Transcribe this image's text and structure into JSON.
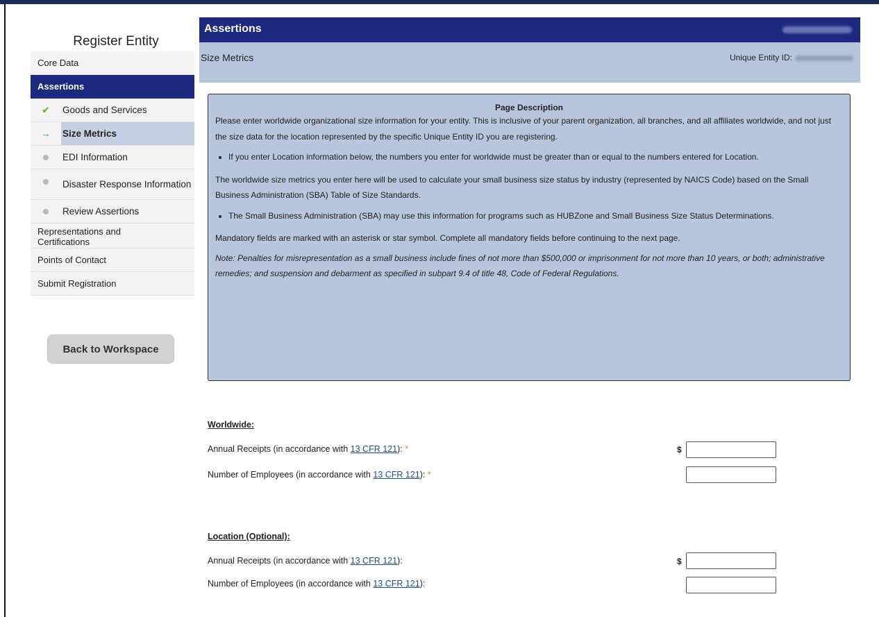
{
  "sidebar": {
    "title": "Register Entity",
    "core_data": "Core Data",
    "assertions": "Assertions",
    "sub_items": [
      {
        "label": "Goods and Services",
        "status": "complete"
      },
      {
        "label": "Size Metrics",
        "status": "current"
      },
      {
        "label": "EDI Information",
        "status": "pending"
      },
      {
        "label": "Disaster Response Information",
        "status": "pending"
      },
      {
        "label": "Review Assertions",
        "status": "pending"
      }
    ],
    "reps_certs": "Representations and Certifications",
    "points_of_contact": "Points of Contact",
    "submit_registration": "Submit Registration",
    "back_button": "Back to Workspace"
  },
  "header": {
    "title": "Assertions",
    "subtitle": "Size Metrics",
    "unique_entity_label": "Unique Entity ID:"
  },
  "description": {
    "title": "Page Description",
    "p1": "Please enter worldwide organizational size information for your entity. This is inclusive of your parent organization, all branches, and all affiliates worldwide, and not just the size data for the location represented by the specific Unique Entity ID you are registering.",
    "bullet1": "If you enter Location information below, the numbers you enter for worldwide must be greater than or equal to the numbers entered for Location.",
    "p2": "The worldwide size metrics you enter here will be used to calculate your small business size status by industry (represented by NAICS Code) based on the Small Business Administration (SBA) Table of Size Standards.",
    "bullet2": "The Small Business Administration (SBA) may use this information for programs such as HUBZone and Small Business Size Status Determinations.",
    "p3": "Mandatory fields are marked with an asterisk or star symbol. Complete all mandatory fields before continuing to the next page.",
    "note": "Note: Penalties for misrepresentation as a small business include fines of not more than $500,000 or imprisonment for not more than 10 years, or both; administrative remedies; and suspension and debarment as specified in subpart 9.4 of title 48, Code of Federal Regulations."
  },
  "worldwide": {
    "title": "Worldwide:",
    "receipts_label": "Annual Receipts (in accordance with ",
    "employees_label": "Number of Employees (in accordance with ",
    "link_text": "13 CFR 121",
    "suffix": "):",
    "required_mark": "*",
    "currency": "$",
    "receipts_value": "",
    "employees_value": ""
  },
  "location": {
    "title": "Location (Optional):",
    "receipts_label": "Annual Receipts (in accordance with ",
    "employees_label": "Number of Employees (in accordance with ",
    "link_text": "13 CFR 121",
    "suffix": "):",
    "currency": "$",
    "receipts_value": "",
    "employees_value": ""
  },
  "colors": {
    "header_blue": "#1b2980",
    "panel_blue": "#b7c6dc",
    "current_item": "#c5d0e4",
    "check_green": "#70b83c",
    "arrow_blue": "#1e90e0",
    "required_orange": "#e47f1f"
  }
}
